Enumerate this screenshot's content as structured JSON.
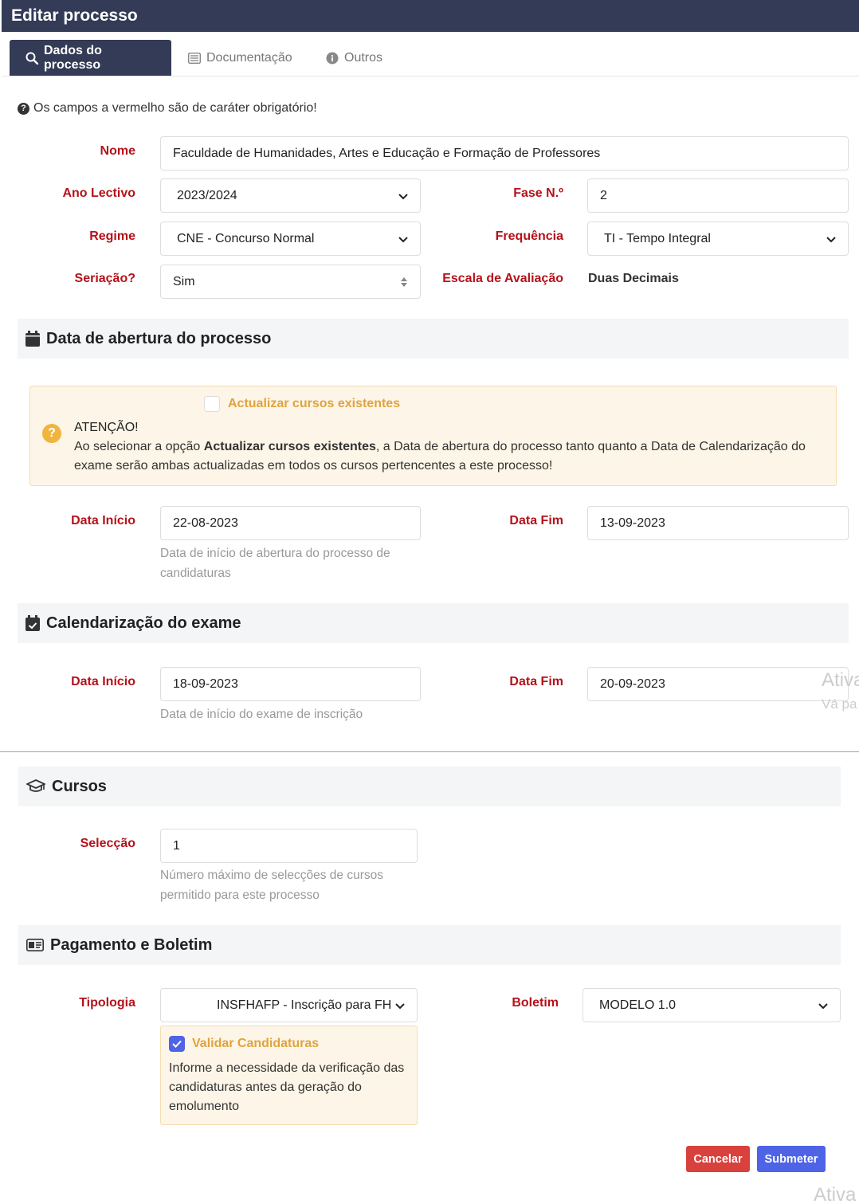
{
  "window": {
    "title": "Editar processo"
  },
  "tabs": [
    {
      "label": "Dados do processo",
      "icon": "search-icon",
      "active": true
    },
    {
      "label": "Documentação",
      "icon": "list-icon",
      "active": false
    },
    {
      "label": "Outros",
      "icon": "info-icon",
      "active": false
    }
  ],
  "note": "Os campos a vermelho são de caráter obrigatório!",
  "form": {
    "nome": {
      "label": "Nome",
      "value": "Faculdade de Humanidades, Artes e Educação e Formação de Professores"
    },
    "ano_lectivo": {
      "label": "Ano Lectivo",
      "value": "2023/2024"
    },
    "fase": {
      "label": "Fase N.º",
      "value": "2"
    },
    "regime": {
      "label": "Regime",
      "value": "CNE - Concurso Normal"
    },
    "frequencia": {
      "label": "Frequência",
      "value": "TI - Tempo Integral"
    },
    "seriacao": {
      "label": "Seriação?",
      "value": "Sim"
    },
    "escala": {
      "label": "Escala de Avaliação",
      "value": "Duas Decimais"
    }
  },
  "abertura": {
    "title": "Data de abertura do processo",
    "checkbox_label": "Actualizar cursos existentes",
    "checkbox_checked": false,
    "warning_title": "ATENÇÃO!",
    "warning_pre": "Ao selecionar a opção ",
    "warning_bold": "Actualizar cursos existentes",
    "warning_line1_post": ", a Data de abertura do processo tanto quanto a Data de Calendarização do",
    "warning_line2": "exame serão ambas actualizadas em todos os cursos pertencentes a este processo!",
    "data_inicio_label": "Data Início",
    "data_inicio": "22-08-2023",
    "data_inicio_help1": "Data de início de abertura do processo de",
    "data_inicio_help2": "candidaturas",
    "data_fim_label": "Data Fim",
    "data_fim": "13-09-2023"
  },
  "exame": {
    "title": "Calendarização do exame",
    "data_inicio_label": "Data Início",
    "data_inicio": "18-09-2023",
    "data_inicio_help": "Data de início do exame de inscrição",
    "data_fim_label": "Data Fim",
    "data_fim": "20-09-2023"
  },
  "cursos": {
    "title": "Cursos",
    "seleccao_label": "Selecção",
    "seleccao": "1",
    "help1": "Número máximo de selecções de cursos",
    "help2": "permitido para este processo"
  },
  "pagamento": {
    "title": "Pagamento e Boletim",
    "tipologia_label": "Tipologia",
    "tipologia": "INSFHAFP - Inscrição para FH",
    "boletim_label": "Boletim",
    "boletim": "MODELO 1.0",
    "validar_label": "Validar Candidaturas",
    "validar_checked": true,
    "validar_help1": "Informe a necessidade da verificação das",
    "validar_help2": "candidaturas antes da geração do",
    "validar_help3": "emolumento"
  },
  "buttons": {
    "cancel": "Cancelar",
    "submit": "Submeter"
  },
  "watermark": {
    "line1": "Ativa",
    "line2": "Vá pa",
    "line3": "Ativa"
  },
  "colors": {
    "header": "#333b56",
    "required": "#b5121b",
    "cancel": "#d9413c",
    "submit": "#4e63e6",
    "warning": "#e0a33e"
  }
}
